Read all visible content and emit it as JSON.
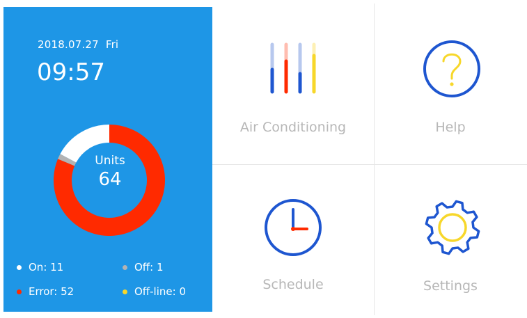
{
  "status": {
    "date": "2018.07.27",
    "weekday": "Fri",
    "time": "09:57",
    "units_label": "Units",
    "units_total": "64",
    "legend": {
      "on": "On: 11",
      "off": "Off: 1",
      "error": "Error: 52",
      "offline": "Off-line: 0"
    },
    "counts": {
      "on": 11,
      "off": 1,
      "error": 52,
      "offline": 0
    },
    "colors": {
      "panel": "#1e96e6",
      "error": "#ff2a00",
      "on": "#ffffff",
      "off": "#b3b3b3",
      "offline": "#f7d72a"
    }
  },
  "tiles": {
    "air_conditioning": {
      "label": "Air Conditioning",
      "icon": "equalizer-bars-icon"
    },
    "help": {
      "label": "Help",
      "icon": "question-circle-icon"
    },
    "schedule": {
      "label": "Schedule",
      "icon": "clock-icon"
    },
    "settings": {
      "label": "Settings",
      "icon": "gear-icon"
    }
  },
  "icon_colors": {
    "blue": "#1e56d0",
    "red": "#ff2a00",
    "yellow": "#f7d72a"
  }
}
